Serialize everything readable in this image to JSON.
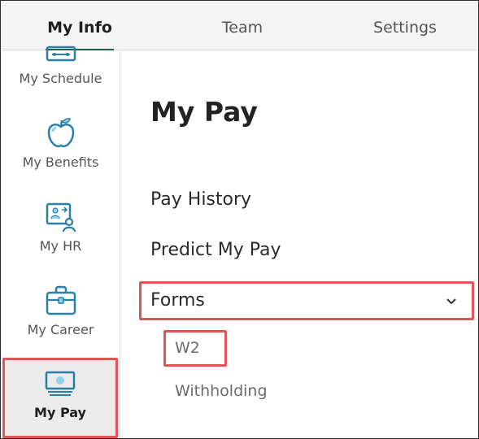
{
  "tabs": [
    {
      "label": "My Info",
      "active": true
    },
    {
      "label": "Team",
      "active": false
    },
    {
      "label": "Settings",
      "active": false
    }
  ],
  "sidebar": {
    "items": [
      {
        "label": "My Schedule",
        "icon": "calendar-icon"
      },
      {
        "label": "My Benefits",
        "icon": "apple-icon"
      },
      {
        "label": "My HR",
        "icon": "people-board-icon"
      },
      {
        "label": "My Career",
        "icon": "briefcase-icon"
      },
      {
        "label": "My Pay",
        "icon": "money-icon",
        "active": true
      }
    ]
  },
  "main": {
    "title": "My Pay",
    "links": [
      "Pay History",
      "Predict My Pay"
    ],
    "forms": {
      "label": "Forms",
      "expanded": true,
      "items": [
        "W2",
        "Withholding"
      ]
    }
  },
  "colors": {
    "accent": "#1d5f4f",
    "icon_teal": "#2a7fa8",
    "icon_light": "#8fd3ea",
    "highlight": "#e05555",
    "active_bg": "#ebebeb"
  }
}
